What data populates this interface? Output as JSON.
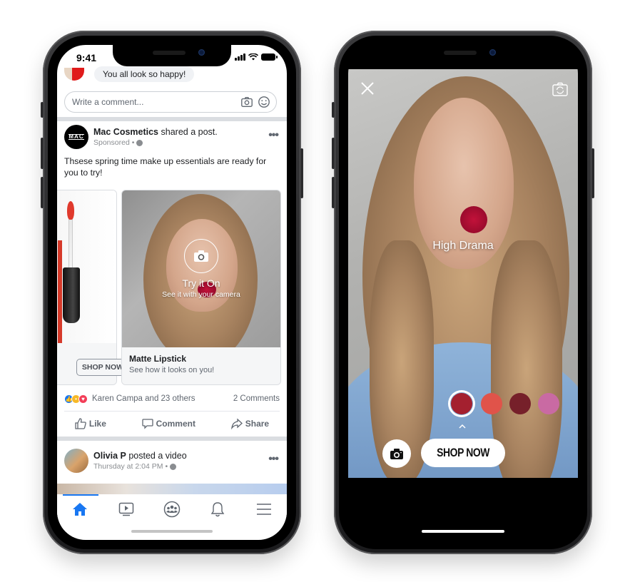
{
  "left_phone": {
    "status_bar": {
      "time": "9:41"
    },
    "previous_comment": {
      "text": "You all look so happy!"
    },
    "comment_input": {
      "placeholder": "Write a comment...",
      "value": ""
    },
    "sponsored_post": {
      "author": "Mac Cosmetics",
      "action": "shared a post.",
      "label": "Sponsored",
      "separator": "•",
      "avatar_text": "MAC",
      "body": "Thsese spring time make up essentials are ready for you to try!",
      "carousel": [
        {
          "cta": "SHOP NOW"
        },
        {
          "overlay_title": "Try it On",
          "overlay_subtitle": "See it with your camera",
          "title": "Matte Lipstick",
          "subtitle": "See how it looks on you!"
        }
      ],
      "reactions": {
        "icons": [
          "like",
          "wow",
          "love"
        ],
        "summary": "Karen Campa and 23 others",
        "comments": "2 Comments"
      },
      "actions": [
        {
          "label": "Like",
          "icon": "thumbs-up-icon"
        },
        {
          "label": "Comment",
          "icon": "comment-icon"
        },
        {
          "label": "Share",
          "icon": "share-icon"
        }
      ]
    },
    "next_post": {
      "author": "Olivia P",
      "action": "posted a video",
      "timestamp": "Thursday at 2:04 PM",
      "separator": "•"
    },
    "tab_bar": [
      {
        "name": "home",
        "active": true
      },
      {
        "name": "watch",
        "active": false
      },
      {
        "name": "groups",
        "active": false
      },
      {
        "name": "notifications",
        "active": false
      },
      {
        "name": "menu",
        "active": false
      }
    ]
  },
  "right_phone": {
    "effect_name": "High Drama",
    "swatches": [
      {
        "color": "#a4202f",
        "selected": true
      },
      {
        "color": "#e0534a",
        "selected": false
      },
      {
        "color": "#76202a",
        "selected": false
      },
      {
        "color": "#c96aa3",
        "selected": false
      }
    ],
    "shop_now_label": "SHOP NOW"
  },
  "colors": {
    "facebook_blue": "#1877f2",
    "lip_red": "#c2123a"
  }
}
